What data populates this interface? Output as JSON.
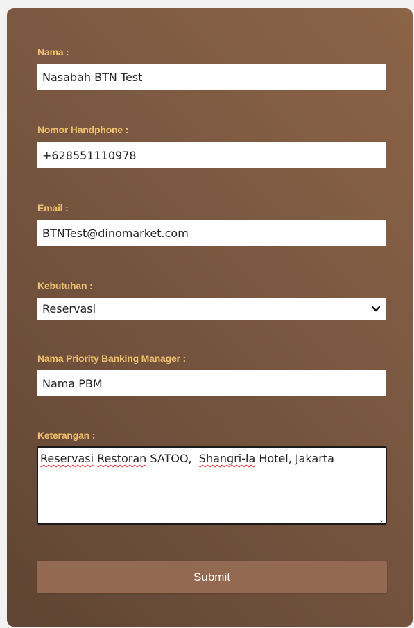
{
  "form": {
    "nama": {
      "label": "Nama :",
      "value": "Nasabah BTN Test"
    },
    "phone": {
      "label": "Nomor Handphone :",
      "value": "+628551110978"
    },
    "email": {
      "label": "Email :",
      "value": "BTNTest@dinomarket.com"
    },
    "kebutuhan": {
      "label": "Kebutuhan :",
      "selected": "Reservasi"
    },
    "pbm": {
      "label": "Nama Priority Banking Manager :",
      "value": "Nama PBM"
    },
    "keterangan": {
      "label": "Keterangan :",
      "words": [
        "Reservasi",
        "Restoran",
        "SATOO,",
        "Shangri-la",
        "Hotel,",
        "Jakarta"
      ]
    },
    "submit_label": "Submit"
  },
  "colors": {
    "label": "#f0c070",
    "button": "#936a51",
    "card_dark": "#5f4433",
    "card_light": "#8b6447"
  }
}
